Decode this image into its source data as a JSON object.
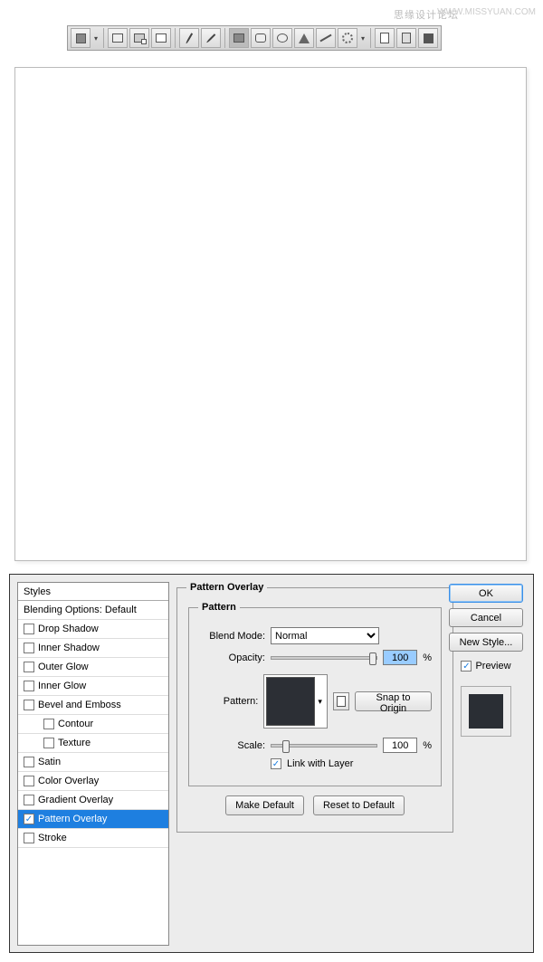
{
  "watermark_cn": "思缘设计论坛",
  "watermark_url": "WWW.MISSYUAN.COM",
  "dialog": {
    "styles_header": "Styles",
    "blending_options": "Blending Options: Default",
    "effects": [
      {
        "label": "Drop Shadow",
        "checked": false
      },
      {
        "label": "Inner Shadow",
        "checked": false
      },
      {
        "label": "Outer Glow",
        "checked": false
      },
      {
        "label": "Inner Glow",
        "checked": false
      },
      {
        "label": "Bevel and Emboss",
        "checked": false
      },
      {
        "label": "Contour",
        "checked": false,
        "indent": true
      },
      {
        "label": "Texture",
        "checked": false,
        "indent": true
      },
      {
        "label": "Satin",
        "checked": false
      },
      {
        "label": "Color Overlay",
        "checked": false
      },
      {
        "label": "Gradient Overlay",
        "checked": false
      },
      {
        "label": "Pattern Overlay",
        "checked": true,
        "selected": true
      },
      {
        "label": "Stroke",
        "checked": false
      }
    ],
    "group_title": "Pattern Overlay",
    "inner_title": "Pattern",
    "blend_mode_label": "Blend Mode:",
    "blend_mode_value": "Normal",
    "opacity_label": "Opacity:",
    "opacity_value": "100",
    "percent": "%",
    "pattern_label": "Pattern:",
    "snap_btn": "Snap to Origin",
    "scale_label": "Scale:",
    "scale_value": "100",
    "link_label": "Link with Layer",
    "make_default": "Make Default",
    "reset_default": "Reset to Default",
    "ok": "OK",
    "cancel": "Cancel",
    "new_style": "New Style...",
    "preview": "Preview"
  }
}
